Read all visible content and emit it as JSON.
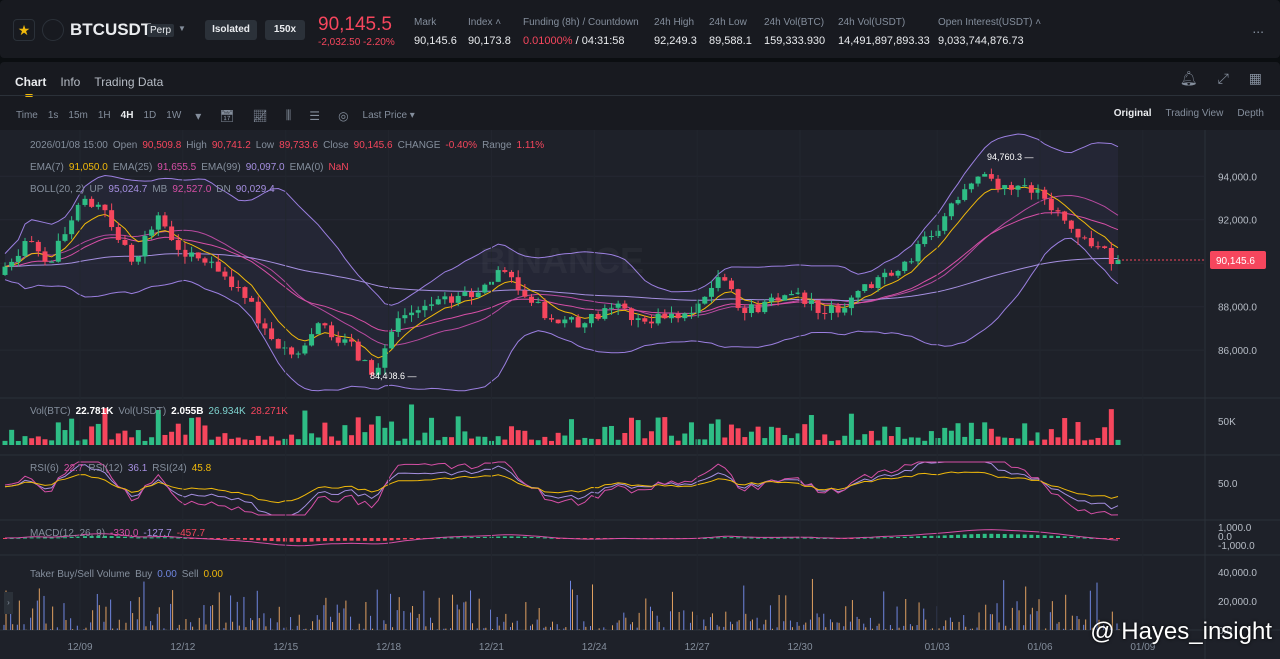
{
  "header": {
    "symbol": "BTCUSDT",
    "contract": "Perp",
    "margin_mode": "Isolated",
    "leverage": "150x",
    "last_price": "90,145.5",
    "change_abs": "-2,032.50",
    "change_pct": "-2.20%",
    "stats": [
      {
        "label": "Mark",
        "value": "90,145.6"
      },
      {
        "label": "Index",
        "value": "90,173.8"
      },
      {
        "label": "Funding (8h) / Countdown",
        "value": "0.01000%",
        "value2": "/ 04:31:58"
      },
      {
        "label": "24h High",
        "value": "92,249.3"
      },
      {
        "label": "24h Low",
        "value": "89,588.1"
      },
      {
        "label": "24h Vol(BTC)",
        "value": "159,333.930"
      },
      {
        "label": "24h Vol(USDT)",
        "value": "14,491,897,893.33"
      },
      {
        "label": "Open Interest(USDT)",
        "value": "9,033,744,876.73"
      }
    ],
    "more": "..."
  },
  "tabs": [
    "Chart",
    "Info",
    "Trading Data"
  ],
  "toolbar": {
    "intervals": [
      "Time",
      "1s",
      "15m",
      "1H",
      "4H",
      "1D",
      "1W"
    ],
    "active": "4H",
    "price_type": "Last Price",
    "views": [
      "Original",
      "Trading View",
      "Depth"
    ],
    "active_view": "Original"
  },
  "ohlc": {
    "date": "2026/01/08 15:00",
    "open_l": "Open",
    "open": "90,509.8",
    "high_l": "High",
    "high": "90,741.2",
    "low_l": "Low",
    "low": "89,733.6",
    "close_l": "Close",
    "close": "90,145.6",
    "change_l": "CHANGE",
    "change": "-0.40%",
    "range_l": "Range",
    "range": "1.11%"
  },
  "ema": {
    "l7": "EMA(7)",
    "v7": "91,050.0",
    "l25": "EMA(25)",
    "v25": "91,655.5",
    "l99": "EMA(99)",
    "v99": "90,097.0",
    "l0": "EMA(0)",
    "v0": "NaN"
  },
  "boll": {
    "l": "BOLL(20, 2)",
    "up_l": "UP",
    "up": "95,024.7",
    "mb_l": "MB",
    "mb": "92,527.0",
    "dn_l": "DN",
    "dn": "90,029.4"
  },
  "vol": {
    "l1": "Vol(BTC)",
    "v1": "22.781K",
    "l2": "Vol(USDT)",
    "v2": "2.055B",
    "ma1": "26.934K",
    "ma2": "28.271K",
    "axis": "50K"
  },
  "rsi": {
    "l6": "RSI(6)",
    "v6": "22.7",
    "l12": "RSI(12)",
    "v12": "36.1",
    "l24": "RSI(24)",
    "v24": "45.8",
    "axis": "50.0"
  },
  "macd": {
    "l": "MACD(12, 26, 9)",
    "dif": "-330.0",
    "dea": "-127.7",
    "hist": "-457.7",
    "axis": [
      "1,000.0",
      "0.0",
      "-1,000.0"
    ]
  },
  "taker": {
    "l": "Taker Buy/Sell Volume",
    "buy_l": "Buy",
    "buy": "0.00",
    "sell_l": "Sell",
    "sell": "0.00",
    "axis": [
      "40,000.0",
      "20,000.0",
      "0.0"
    ]
  },
  "watermark": "BINANCE",
  "credit": "@ Hayes_insight",
  "colors": {
    "up": "#2ebd85",
    "down": "#f6465d",
    "accent": "#f0b90b",
    "ema7": "#f0b90b",
    "ema25": "#d64fa6",
    "ema99": "#a58fe0",
    "boll": "#9b7fe0"
  },
  "chart_data": {
    "type": "candlestick",
    "price_axis": [
      "94,000.0",
      "92,000.0",
      "90,000.0",
      "88,000.0",
      "86,000.0"
    ],
    "ylim": [
      83800,
      95300
    ],
    "x_ticks": [
      "12/09",
      "12/12",
      "12/15",
      "12/18",
      "12/21",
      "12/24",
      "12/27",
      "12/30",
      "01/03",
      "01/06",
      "01/09"
    ],
    "closes": [
      89460,
      91020,
      90070,
      92680,
      92440,
      90070,
      92200,
      90300,
      90070,
      88900,
      87000,
      85800,
      87240,
      86500,
      84870,
      87470,
      88040,
      88180,
      88650,
      89600,
      88180,
      87240,
      87240,
      87950,
      87470,
      87470,
      87710,
      89360,
      87710,
      88420,
      88650,
      87710,
      88420,
      89360,
      90070,
      91250,
      92910,
      94100,
      93380,
      93380,
      91960,
      90780,
      90145.6
    ],
    "high_label": "94,760.3",
    "low_label": "84,408.6",
    "last_label": "90,145.6"
  }
}
